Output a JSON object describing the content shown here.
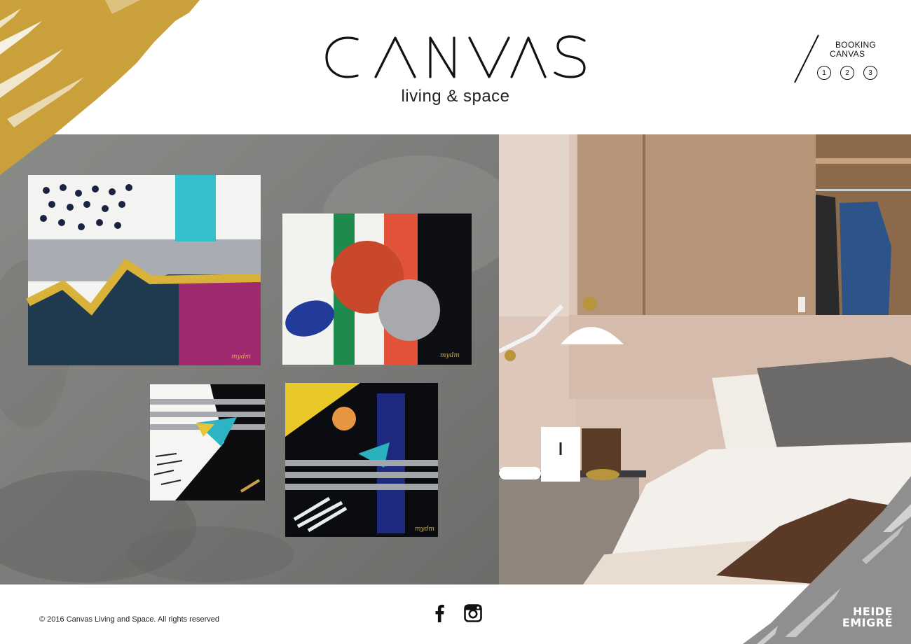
{
  "brand": {
    "name": "CANVAS",
    "tagline": "living & space"
  },
  "booking": {
    "line1": "BOOKING",
    "line2": "CANVAS",
    "steps": [
      "1",
      "2",
      "3"
    ]
  },
  "hero": {
    "painting_signature": "mydm"
  },
  "footer": {
    "copyright": "© 2016 Canvas Living and Space. All rights reserved",
    "social": [
      "facebook-icon",
      "instagram-icon"
    ]
  },
  "designer_mark": {
    "line1": "HEIDE",
    "line2": "EMIGRÉ"
  },
  "colors": {
    "gold": "#C9A03A",
    "gray_corner": "#8F8F8F",
    "text": "#111111"
  }
}
